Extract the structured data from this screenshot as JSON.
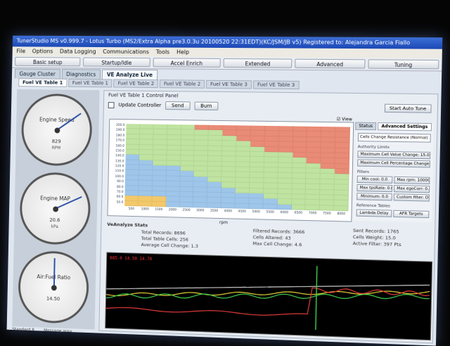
{
  "window": {
    "title": "TunerStudio MS v0.999.7 - Lotus Turbo (MS2/Extra Alpha pre3.0.3u 20100520 22:31EDT)(KC/JSM/JB v5) Registered to: Alejandra Garcia Fiallo"
  },
  "menu": [
    "File",
    "Options",
    "Data Logging",
    "Communications",
    "Tools",
    "Help"
  ],
  "toolbar": [
    "Basic setup",
    "Startup/Idle",
    "Accel Enrich",
    "Extended",
    "Advanced",
    "Tuning"
  ],
  "main_tabs": [
    "Gauge Cluster",
    "Diagnostics",
    "VE Analyze Live"
  ],
  "sub_tabs": [
    "Fuel VE Table 1",
    "Fuel VE Table 1",
    "Fuel VE Table 2",
    "Fuel VE Table 2",
    "Fuel VE Table 3",
    "Fuel VE Table 3"
  ],
  "gauges": [
    {
      "title": "Engine Speed",
      "value": "829",
      "unit": "RPM",
      "needle_deg": 235
    },
    {
      "title": "Engine MAP",
      "value": "20.6",
      "unit": "kPa",
      "needle_deg": 245
    },
    {
      "title": "Air:Fuel Ratio",
      "value": "14.50",
      "unit": "",
      "needle_deg": 180
    }
  ],
  "panel": {
    "title": "Fuel VE Table 1 Control Panel",
    "update_controller": "Update Controller",
    "send": "Send",
    "burn": "Burn",
    "ve_label": "ve",
    "start_button": "Start Auto Tune",
    "view_label": "View",
    "xaxis_label": "rpm"
  },
  "ve_table": {
    "rows": [
      "200.0",
      "190.0",
      "180.0",
      "170.0",
      "160.0",
      "150.0",
      "140.0",
      "130.0",
      "120.0",
      "110.0",
      "100.0",
      "90.0",
      "80.0",
      "70.0",
      "60.0",
      "50.0"
    ],
    "cols": [
      "500",
      "1000",
      "1500",
      "2000",
      "2500",
      "3000",
      "3500",
      "4000",
      "4500",
      "5000",
      "5500",
      "6000",
      "6500",
      "7000",
      "7500",
      "8000"
    ]
  },
  "sidepane": {
    "tabs": [
      "Status",
      "Advanced Settings"
    ],
    "select": "Cells Change Resistance (Normal)",
    "authority_heading": "Authority Limits",
    "authority_buttons": [
      "Maximum Cell Value Change: 15.0",
      "Maximum Cell Percentage Change: 15.0"
    ],
    "filters_heading": "Filters",
    "filter_buttons": [
      [
        "Min cool: 0.0",
        "Max rpm: 10000.0"
      ],
      [
        "Max tpsRate: 0.0",
        "Max egoCorr: 0.0"
      ],
      [
        "Minimum: 0.0",
        "Custom filter: Off"
      ]
    ],
    "reference_heading": "Reference Tables",
    "reference_buttons": [
      "Lambda Delay",
      "AFR Targets"
    ]
  },
  "stats": {
    "heading": "VeAnalyze Stats",
    "total_records": "Total Records: 8696",
    "total_cells": "Total Table Cells: 256",
    "avg_cell_change": "Average Cell Change: 1.3",
    "filtered_records": "Filtered Records: 3666",
    "cells_altered": "Cells Altered: 43",
    "max_cell_change": "Max Cell Change: 4.6",
    "sent_records": "Sent Records: 1765",
    "cells_weight": "Cells Weight: 15.0",
    "active_filter": "Active Filter: 397 Pts"
  },
  "log": {
    "rate": "885.0  14.50  14.70"
  },
  "footer": [
    "Standard 8",
    "Message area"
  ],
  "colors": {
    "accent": "#1c48b5",
    "ve_low": "#9ec6ea",
    "ve_mid": "#bfe3a0",
    "ve_high": "#e98b76"
  }
}
